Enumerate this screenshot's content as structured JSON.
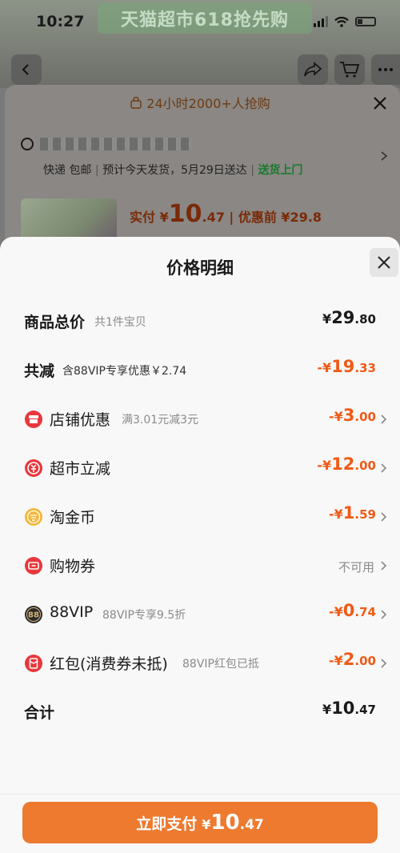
{
  "status": {
    "time": "10:27"
  },
  "background": {
    "banner_text": "天猫超市618抢先购",
    "hot_text": "24小时2000+人抢购",
    "shipping": {
      "method": "快递 包邮",
      "eta": "预计今天发货，5月29日送达",
      "door": "送货上门"
    },
    "price": {
      "paid_label": "实付",
      "currency": "¥",
      "paid_int": "10",
      "paid_dec": ".47",
      "before_label": "优惠前",
      "before_value": "¥29.8"
    }
  },
  "sheet": {
    "title": "价格明细",
    "rows": [
      {
        "label": "商品总价",
        "sub": "共1件宝贝",
        "currency": "¥",
        "int": "29",
        "dec": ".80",
        "sign": ""
      },
      {
        "label": "共减",
        "sub": "含88VIP专享优惠￥2.74",
        "currency": "¥",
        "int": "19",
        "dec": ".33",
        "sign": "-"
      },
      {
        "label": "店铺优惠",
        "sub": "满3.01元减3元",
        "currency": "¥",
        "int": "3",
        "dec": ".00",
        "sign": "-",
        "icon": "store-icon",
        "color": "#e8383d"
      },
      {
        "label": "超市立减",
        "sub": "",
        "currency": "¥",
        "int": "12",
        "dec": ".00",
        "sign": "-",
        "icon": "coin-icon",
        "color": "#e8383d"
      },
      {
        "label": "淘金币",
        "sub": "",
        "currency": "¥",
        "int": "1",
        "dec": ".59",
        "sign": "-",
        "icon": "gold-coin-icon",
        "color": "#f4b63a"
      },
      {
        "label": "购物券",
        "sub": "",
        "na": "不可用",
        "icon": "voucher-icon",
        "color": "#e8383d"
      },
      {
        "label": "88VIP",
        "sub": "88VIP专享9.5折",
        "currency": "¥",
        "int": "0",
        "dec": ".74",
        "sign": "-",
        "icon": "vip-icon",
        "icon_text": "88",
        "color": "#2b2b2b"
      },
      {
        "label": "红包(消费券未抵)",
        "sub": "88VIP红包已抵",
        "currency": "¥",
        "int": "2",
        "dec": ".00",
        "sign": "-",
        "icon": "red-envelope-icon",
        "color": "#e8383d"
      },
      {
        "label": "合计",
        "sub": "",
        "currency": "¥",
        "int": "10",
        "dec": ".47",
        "sign": ""
      }
    ],
    "pay_button": {
      "label": "立即支付",
      "currency": "¥",
      "int": "10",
      "dec": ".47"
    }
  },
  "colors": {
    "accent": "#ee7a30",
    "discount": "#f05a16",
    "green": "#1a7a2e"
  }
}
